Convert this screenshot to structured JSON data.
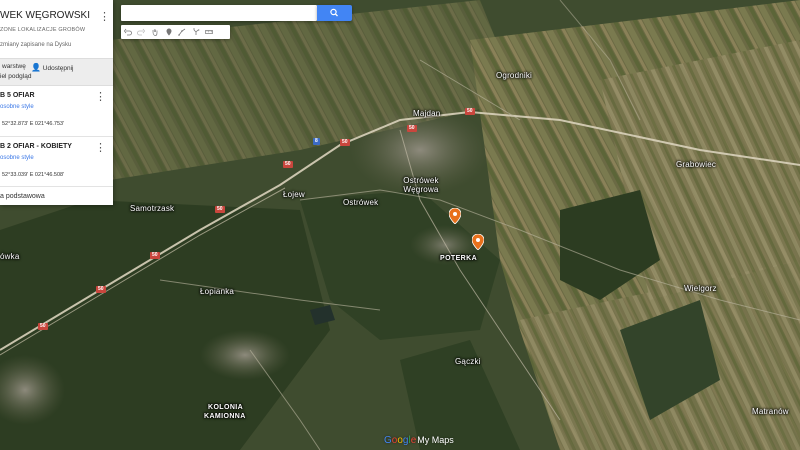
{
  "panel": {
    "title": "WEK WĘGROWSKI",
    "subtitle": "ZONE LOKALIZACJE GROBÓW",
    "saved_note": "zmiany zapisane na Dysku",
    "toolbar": {
      "layer_label": "warstwę",
      "share_label": "Udostępnij",
      "preview_label": "iel podgląd"
    },
    "layers": [
      {
        "title": "B 5 OFIAR",
        "style_link": "osobne style",
        "coords": "52°32.873' E 021°46.753'"
      },
      {
        "title": "B 2 OFIAR - KOBIETY",
        "style_link": "osobne style",
        "coords": "52°33.039' E 021°46.508'"
      }
    ],
    "base_map": "a podstawowa"
  },
  "search": {
    "value": "",
    "placeholder": ""
  },
  "tools": [
    "undo-icon",
    "redo-icon",
    "hand-icon",
    "marker-icon",
    "line-icon",
    "route-icon",
    "ruler-icon"
  ],
  "map": {
    "places": [
      {
        "name": "Ogrodniki"
      },
      {
        "name": "Majdan"
      },
      {
        "name": "Grabowiec"
      },
      {
        "name": "Łojew"
      },
      {
        "name": "Ostrówek"
      },
      {
        "name": "Ostrówek Węgrowa"
      },
      {
        "name": "Samotrzask"
      },
      {
        "name": "ówka"
      },
      {
        "name": "POTERKA"
      },
      {
        "name": "Łopianka"
      },
      {
        "name": "Wielgorz"
      },
      {
        "name": "Gączki"
      },
      {
        "name": "Matranów"
      },
      {
        "name": "KOLONIA"
      },
      {
        "name": "KAMIONNA"
      }
    ],
    "routes": [
      {
        "label": "50"
      },
      {
        "label": "50"
      },
      {
        "label": "50"
      },
      {
        "label": "50"
      },
      {
        "label": "50"
      },
      {
        "label": "50"
      },
      {
        "label": "50"
      },
      {
        "label": "50"
      },
      {
        "label": "8"
      }
    ],
    "pin_color": "#e8711c"
  },
  "footer": {
    "google": [
      "G",
      "o",
      "o",
      "g",
      "l",
      "e"
    ],
    "mymaps": "My Maps"
  }
}
